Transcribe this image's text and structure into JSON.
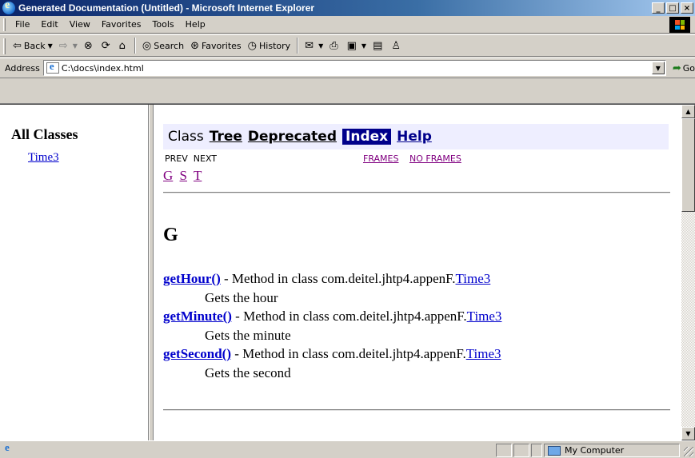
{
  "window": {
    "title": "Generated Documentation (Untitled) - Microsoft Internet Explorer",
    "controls": [
      "_",
      "□",
      "×"
    ]
  },
  "menubar": {
    "items": [
      "File",
      "Edit",
      "View",
      "Favorites",
      "Tools",
      "Help"
    ]
  },
  "toolbar": {
    "back": "Back",
    "search": "Search",
    "favorites": "Favorites",
    "history": "History",
    "icons": [
      "back-arrow-icon",
      "forward-arrow-icon",
      "stop-icon",
      "refresh-icon",
      "home-icon",
      "search-icon",
      "favorites-icon",
      "history-icon",
      "edit-icon",
      "print-icon",
      "word-icon",
      "discuss-icon",
      "messenger-icon"
    ]
  },
  "address": {
    "label": "Address",
    "value": "C:\\docs\\index.html",
    "go_label": "Go"
  },
  "left_frame": {
    "heading": "All Classes",
    "classes": [
      "Time3"
    ]
  },
  "right_frame": {
    "nav": {
      "class": "Class",
      "tree": "Tree",
      "deprecated": "Deprecated",
      "index": "Index",
      "help": "Help"
    },
    "subnav": {
      "prev": "PREV",
      "next": "NEXT",
      "frames": "FRAMES",
      "no_frames": "NO FRAMES"
    },
    "letters": [
      "G",
      "S",
      "T"
    ],
    "section_letter": "G",
    "entries": [
      {
        "method": "getHour()",
        "text": " - Method in class com.deitel.jhtp4.appenF.",
        "class": "Time3",
        "desc": "Gets the hour"
      },
      {
        "method": "getMinute()",
        "text": " - Method in class com.deitel.jhtp4.appenF.",
        "class": "Time3",
        "desc": "Gets the minute"
      },
      {
        "method": "getSecond()",
        "text": " - Method in class com.deitel.jhtp4.appenF.",
        "class": "Time3",
        "desc": "Gets the second"
      }
    ]
  },
  "statusbar": {
    "zone": "My Computer"
  }
}
